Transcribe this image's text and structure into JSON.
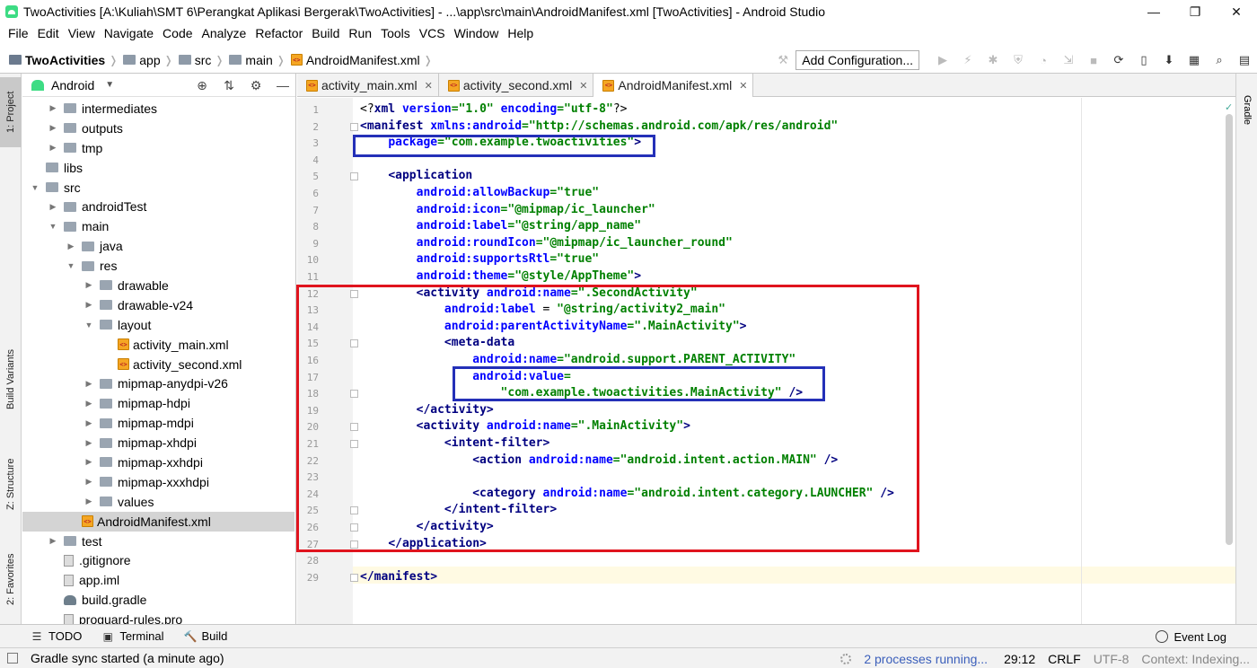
{
  "window": {
    "title": "TwoActivities [A:\\Kuliah\\SMT 6\\Perangkat Aplikasi Bergerak\\TwoActivities] - ...\\app\\src\\main\\AndroidManifest.xml [TwoActivities] - Android Studio",
    "min": "—",
    "max": "❐",
    "close": "✕"
  },
  "menu": [
    "File",
    "Edit",
    "View",
    "Navigate",
    "Code",
    "Analyze",
    "Refactor",
    "Build",
    "Run",
    "Tools",
    "VCS",
    "Window",
    "Help"
  ],
  "breadcrumb": [
    "TwoActivities",
    "app",
    "src",
    "main",
    "AndroidManifest.xml"
  ],
  "toolbar": {
    "add_configuration": "Add Configuration..."
  },
  "project_panel": {
    "view": "Android",
    "tree": [
      {
        "label": "intermediates",
        "level": 3,
        "type": "folder",
        "arrow": "▶"
      },
      {
        "label": "outputs",
        "level": 3,
        "type": "folder",
        "arrow": "▶"
      },
      {
        "label": "tmp",
        "level": 3,
        "type": "folder",
        "arrow": "▶"
      },
      {
        "label": "libs",
        "level": 2,
        "type": "folder",
        "arrow": ""
      },
      {
        "label": "src",
        "level": 2,
        "type": "folder",
        "arrow": "▼"
      },
      {
        "label": "androidTest",
        "level": 3,
        "type": "folder",
        "arrow": "▶"
      },
      {
        "label": "main",
        "level": 3,
        "type": "folder",
        "arrow": "▼"
      },
      {
        "label": "java",
        "level": 4,
        "type": "folder",
        "arrow": "▶"
      },
      {
        "label": "res",
        "level": 4,
        "type": "folder",
        "arrow": "▼"
      },
      {
        "label": "drawable",
        "level": 5,
        "type": "folder",
        "arrow": "▶"
      },
      {
        "label": "drawable-v24",
        "level": 5,
        "type": "folder",
        "arrow": "▶"
      },
      {
        "label": "layout",
        "level": 5,
        "type": "folder",
        "arrow": "▼"
      },
      {
        "label": "activity_main.xml",
        "level": 6,
        "type": "xml",
        "arrow": ""
      },
      {
        "label": "activity_second.xml",
        "level": 6,
        "type": "xml",
        "arrow": ""
      },
      {
        "label": "mipmap-anydpi-v26",
        "level": 5,
        "type": "folder",
        "arrow": "▶"
      },
      {
        "label": "mipmap-hdpi",
        "level": 5,
        "type": "folder",
        "arrow": "▶"
      },
      {
        "label": "mipmap-mdpi",
        "level": 5,
        "type": "folder",
        "arrow": "▶"
      },
      {
        "label": "mipmap-xhdpi",
        "level": 5,
        "type": "folder",
        "arrow": "▶"
      },
      {
        "label": "mipmap-xxhdpi",
        "level": 5,
        "type": "folder",
        "arrow": "▶"
      },
      {
        "label": "mipmap-xxxhdpi",
        "level": 5,
        "type": "folder",
        "arrow": "▶"
      },
      {
        "label": "values",
        "level": 5,
        "type": "folder",
        "arrow": "▶"
      },
      {
        "label": "AndroidManifest.xml",
        "level": 4,
        "type": "xml",
        "arrow": "",
        "selected": true
      },
      {
        "label": "test",
        "level": 3,
        "type": "folder",
        "arrow": "▶"
      },
      {
        "label": ".gitignore",
        "level": 3,
        "type": "file",
        "arrow": ""
      },
      {
        "label": "app.iml",
        "level": 3,
        "type": "file",
        "arrow": ""
      },
      {
        "label": "build.gradle",
        "level": 3,
        "type": "gradle",
        "arrow": ""
      },
      {
        "label": "proguard-rules.pro",
        "level": 3,
        "type": "file",
        "arrow": ""
      }
    ]
  },
  "left_tabs": [
    "1: Project",
    "Build Variants",
    "Z: Structure",
    "2: Favorites"
  ],
  "right_tabs": [
    "Gradle"
  ],
  "editor_tabs": [
    {
      "label": "activity_main.xml",
      "active": false
    },
    {
      "label": "activity_second.xml",
      "active": false
    },
    {
      "label": "AndroidManifest.xml",
      "active": true
    }
  ],
  "code_lines": [
    [
      [
        "pl",
        "<?"
      ],
      [
        "tg",
        "xml "
      ],
      [
        "at",
        "version"
      ],
      [
        "vl",
        "=\"1.0\" "
      ],
      [
        "at",
        "encoding"
      ],
      [
        "vl",
        "=\"utf-8\""
      ],
      [
        "pl",
        "?>"
      ]
    ],
    [
      [
        "tg",
        "<manifest "
      ],
      [
        "at",
        "xmlns:android"
      ],
      [
        "vl",
        "=\"http://schemas.android.com/apk/res/android\""
      ]
    ],
    [
      [
        "pl",
        "    "
      ],
      [
        "at",
        "package"
      ],
      [
        "vl",
        "=\"com.example.twoactivities\""
      ],
      [
        "tg",
        ">"
      ]
    ],
    [
      [
        "pl",
        ""
      ]
    ],
    [
      [
        "pl",
        "    "
      ],
      [
        "tg",
        "<application"
      ]
    ],
    [
      [
        "pl",
        "        "
      ],
      [
        "at",
        "android:allowBackup"
      ],
      [
        "vl",
        "=\"true\""
      ]
    ],
    [
      [
        "pl",
        "        "
      ],
      [
        "at",
        "android:icon"
      ],
      [
        "vl",
        "=\"@mipmap/ic_launcher\""
      ]
    ],
    [
      [
        "pl",
        "        "
      ],
      [
        "at",
        "android:label"
      ],
      [
        "vl",
        "=\"@string/app_name\""
      ]
    ],
    [
      [
        "pl",
        "        "
      ],
      [
        "at",
        "android:roundIcon"
      ],
      [
        "vl",
        "=\"@mipmap/ic_launcher_round\""
      ]
    ],
    [
      [
        "pl",
        "        "
      ],
      [
        "at",
        "android:supportsRtl"
      ],
      [
        "vl",
        "=\"true\""
      ]
    ],
    [
      [
        "pl",
        "        "
      ],
      [
        "at",
        "android:theme"
      ],
      [
        "vl",
        "=\"@style/AppTheme\""
      ],
      [
        "tg",
        ">"
      ]
    ],
    [
      [
        "pl",
        "        "
      ],
      [
        "tg",
        "<activity "
      ],
      [
        "at",
        "android:name"
      ],
      [
        "vl",
        "=\".SecondActivity\""
      ]
    ],
    [
      [
        "pl",
        "            "
      ],
      [
        "at",
        "android:label "
      ],
      [
        "pl",
        "= "
      ],
      [
        "vl",
        "\"@string/activity2_main\""
      ]
    ],
    [
      [
        "pl",
        "            "
      ],
      [
        "at",
        "android:parentActivityName"
      ],
      [
        "vl",
        "=\".MainActivity\""
      ],
      [
        "tg",
        ">"
      ]
    ],
    [
      [
        "pl",
        "            "
      ],
      [
        "tg",
        "<meta-data"
      ]
    ],
    [
      [
        "pl",
        "                "
      ],
      [
        "at",
        "android:name"
      ],
      [
        "vl",
        "=\"android.support.PARENT_ACTIVITY\""
      ]
    ],
    [
      [
        "pl",
        "                "
      ],
      [
        "at",
        "android:value"
      ],
      [
        "vl",
        "="
      ]
    ],
    [
      [
        "pl",
        "                    "
      ],
      [
        "vl",
        "\"com.example.twoactivities.MainActivity\" "
      ],
      [
        "tg",
        "/>"
      ]
    ],
    [
      [
        "pl",
        "        "
      ],
      [
        "tg",
        "</activity>"
      ]
    ],
    [
      [
        "pl",
        "        "
      ],
      [
        "tg",
        "<activity "
      ],
      [
        "at",
        "android:name"
      ],
      [
        "vl",
        "=\".MainActivity\""
      ],
      [
        "tg",
        ">"
      ]
    ],
    [
      [
        "pl",
        "            "
      ],
      [
        "tg",
        "<intent-filter>"
      ]
    ],
    [
      [
        "pl",
        "                "
      ],
      [
        "tg",
        "<action "
      ],
      [
        "at",
        "android:name"
      ],
      [
        "vl",
        "=\"android.intent.action.MAIN\" "
      ],
      [
        "tg",
        "/>"
      ]
    ],
    [
      [
        "pl",
        ""
      ]
    ],
    [
      [
        "pl",
        "                "
      ],
      [
        "tg",
        "<category "
      ],
      [
        "at",
        "android:name"
      ],
      [
        "vl",
        "=\"android.intent.category.LAUNCHER\" "
      ],
      [
        "tg",
        "/>"
      ]
    ],
    [
      [
        "pl",
        "            "
      ],
      [
        "tg",
        "</intent-filter>"
      ]
    ],
    [
      [
        "pl",
        "        "
      ],
      [
        "tg",
        "</activity>"
      ]
    ],
    [
      [
        "pl",
        "    "
      ],
      [
        "tg",
        "</application>"
      ]
    ],
    [
      [
        "pl",
        ""
      ]
    ],
    [
      [
        "tg",
        "</manifest>"
      ]
    ]
  ],
  "bottom_tools": [
    {
      "icon": "☰",
      "label": "TODO"
    },
    {
      "icon": "▣",
      "label": "Terminal"
    },
    {
      "icon": "🔨",
      "label": "Build"
    }
  ],
  "event_log": "Event Log",
  "status": {
    "message": "Gradle sync started (a minute ago)",
    "processes": "2 processes running...",
    "position": "29:12",
    "line_sep": "CRLF",
    "encoding": "UTF-8",
    "context": "Context: Indexing..."
  }
}
